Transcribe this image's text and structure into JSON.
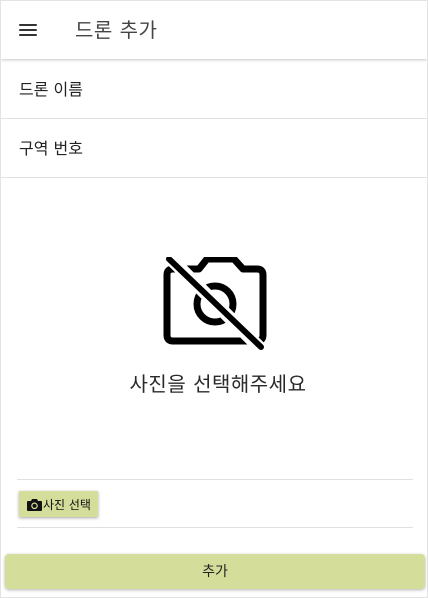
{
  "appbar": {
    "title": "드론 추가",
    "menu_icon": "menu-icon"
  },
  "form": {
    "drone_name_placeholder": "드론 이름",
    "drone_name_value": "",
    "zone_number_placeholder": "구역 번호",
    "zone_number_value": ""
  },
  "photo": {
    "icon": "no-photo-icon",
    "caption": "사진을 선택해주세요",
    "select_button_label": "사진 선택",
    "select_button_icon": "camera-icon"
  },
  "actions": {
    "submit_label": "추가"
  },
  "colors": {
    "button_background": "#d4de9a",
    "app_bar": "#ffffff",
    "text": "#222222"
  }
}
